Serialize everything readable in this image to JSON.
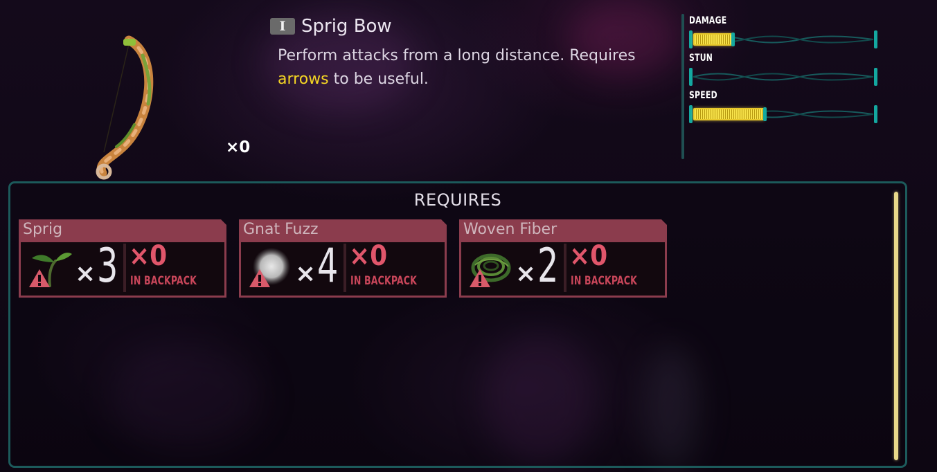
{
  "item": {
    "tier": "I",
    "name": "Sprig Bow",
    "description_before": "Perform attacks from a long distance. Requires ",
    "description_keyword": "arrows",
    "description_after": " to be useful.",
    "owned": "×0"
  },
  "stats": [
    {
      "label": "DAMAGE",
      "fill": 0.22
    },
    {
      "label": "STUN",
      "fill": 0.0
    },
    {
      "label": "SPEED",
      "fill": 0.4
    }
  ],
  "requires": {
    "title": "REQUIRES",
    "in_backpack_label": "IN BACKPACK",
    "items": [
      {
        "name": "Sprig",
        "need_x": "×",
        "need": "3",
        "have": "×0",
        "icon": "sprig-icon"
      },
      {
        "name": "Gnat Fuzz",
        "need_x": "×",
        "need": "4",
        "have": "×0",
        "icon": "gnat-fuzz-icon"
      },
      {
        "name": "Woven Fiber",
        "need_x": "×",
        "need": "2",
        "have": "×0",
        "icon": "woven-fiber-icon"
      }
    ]
  },
  "colors": {
    "accent_teal": "#1c5a5b",
    "card_red": "#8b3c4d",
    "missing_red": "#e0566b",
    "stat_yellow": "#f7e24a",
    "keyword_yellow": "#f5d623"
  }
}
